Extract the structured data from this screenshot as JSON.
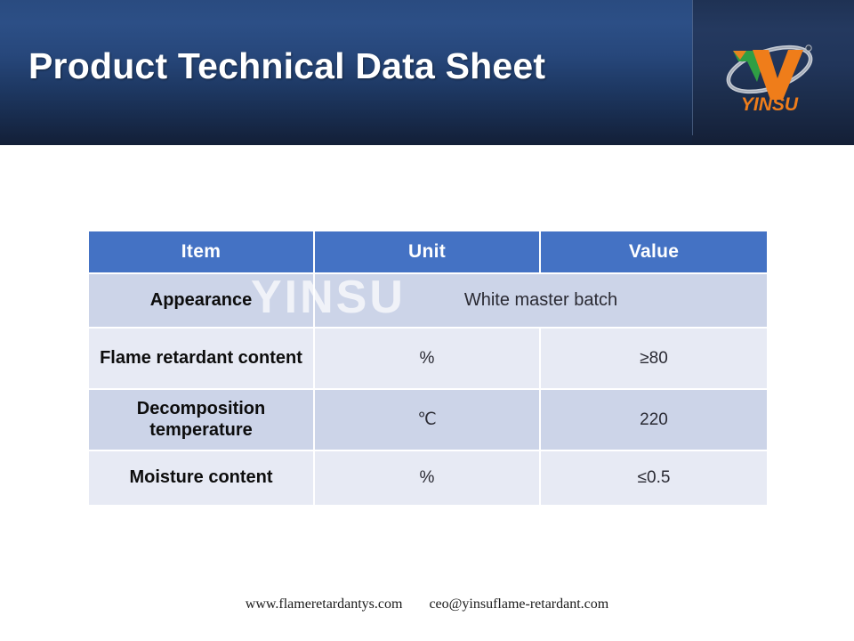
{
  "header": {
    "title": "Product Technical Data Sheet",
    "brand": {
      "name": "YINSU",
      "mark_colors": {
        "green": "#2f9e44",
        "orange": "#ef7d1a",
        "swoosh": "#c8ccd4"
      }
    },
    "background_colors": {
      "top": "#2c4f86",
      "bottom": "#131f37"
    }
  },
  "watermark": {
    "text": "YINSU"
  },
  "table": {
    "accent_color": "#4472c4",
    "band_dark": "#ccd4e8",
    "band_light": "#e7eaf4",
    "columns": [
      "Item",
      "Unit",
      "Value"
    ],
    "rows": [
      {
        "item": "Appearance",
        "unit": "",
        "value": "White master batch",
        "merged": true,
        "merged_text": "White master batch"
      },
      {
        "item": "Flame retardant content",
        "unit": "%",
        "value": "≥80",
        "merged": false
      },
      {
        "item": "Decomposition temperature",
        "unit": "℃",
        "value": "220",
        "merged": false
      },
      {
        "item": "Moisture content",
        "unit": "%",
        "value": "≤0.5",
        "merged": false
      }
    ]
  },
  "footer": {
    "website": "www.flameretardantys.com",
    "email": "ceo@yinsuflame-retardant.com"
  }
}
